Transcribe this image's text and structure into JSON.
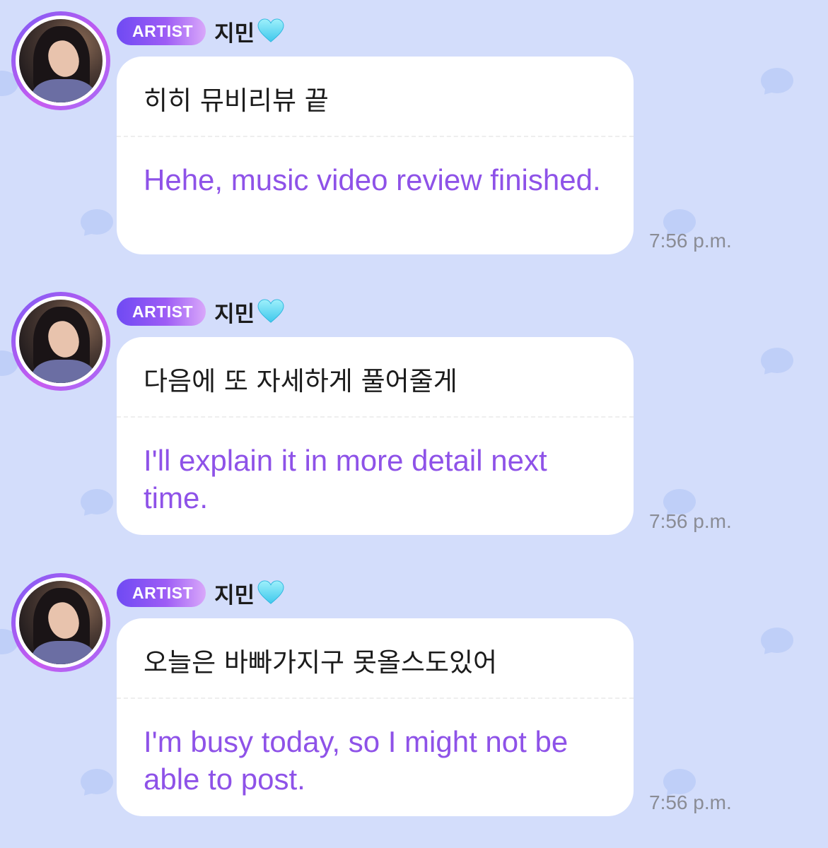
{
  "theme": {
    "background": "#d3ddfb",
    "accent": "#8e52e8",
    "badge_gradient": [
      "#6f4af3",
      "#d9a8fa"
    ],
    "heart_color": "#6fd8f5"
  },
  "messages": [
    {
      "badge": "ARTIST",
      "name": "지민",
      "original": "히히 뮤비리뷰 끝",
      "translation": "Hehe, music video review finished.",
      "time": "7:56 p.m."
    },
    {
      "badge": "ARTIST",
      "name": "지민",
      "original": "다음에 또 자세하게 풀어줄게",
      "translation": "I'll explain it in more detail next time.",
      "time": "7:56 p.m."
    },
    {
      "badge": "ARTIST",
      "name": "지민",
      "original": "오늘은 바빠가지구 못올스도있어",
      "translation": "I'm busy today, so I might not be able to post.",
      "time": "7:56 p.m."
    }
  ]
}
